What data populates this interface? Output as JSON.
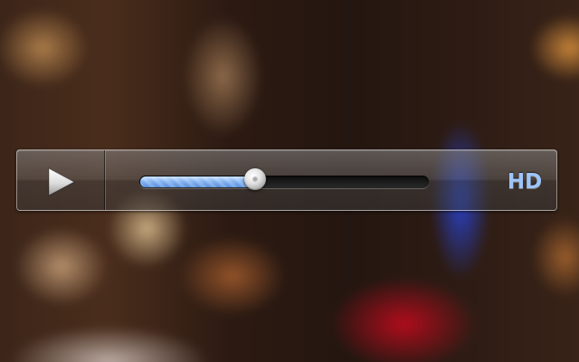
{
  "player": {
    "play_icon": "play-icon",
    "seek": {
      "progress": 0.4
    },
    "hd_label": "HD",
    "colors": {
      "accent": "#7fb0f0",
      "hd_text": "#9ec4f7"
    }
  }
}
